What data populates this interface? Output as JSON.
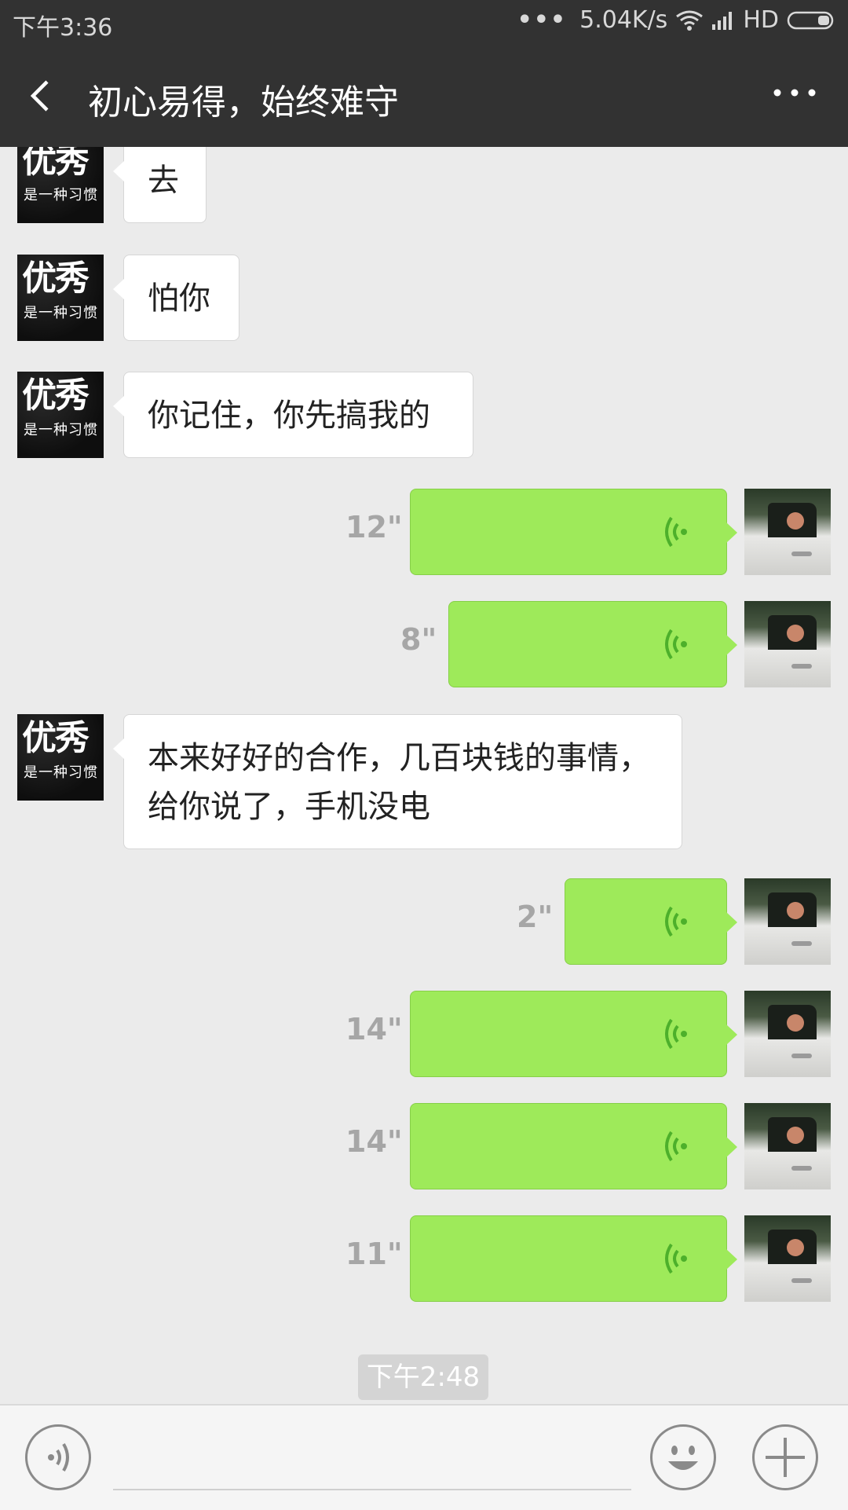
{
  "status_bar": {
    "time": "下午3:36",
    "signal_dots": "•••",
    "speed": "5.04K/s",
    "network_type": "HD"
  },
  "header": {
    "title": "初心易得，始终难守"
  },
  "contact_avatar": {
    "line1": "优秀",
    "line2": "是一种习惯"
  },
  "messages": [
    {
      "side": "left",
      "type": "text",
      "text": "去"
    },
    {
      "side": "left",
      "type": "text",
      "text": "怕你"
    },
    {
      "side": "left",
      "type": "text",
      "text": "你记住，你先搞我的"
    },
    {
      "side": "right",
      "type": "voice",
      "duration": "12\""
    },
    {
      "side": "right",
      "type": "voice",
      "duration": "8\""
    },
    {
      "side": "left",
      "type": "text",
      "text": "本来好好的合作，几百块钱的事情，给你说了，手机没电"
    },
    {
      "side": "right",
      "type": "voice",
      "duration": "2\""
    },
    {
      "side": "right",
      "type": "voice",
      "duration": "14\""
    },
    {
      "side": "right",
      "type": "voice",
      "duration": "14\""
    },
    {
      "side": "right",
      "type": "voice",
      "duration": "11\""
    }
  ],
  "timestamp": "下午2:48",
  "input": {
    "placeholder": "",
    "value": ""
  },
  "icons": {
    "back": "back-arrow-icon",
    "more": "more-dots-icon",
    "voice_input": "voice-input-icon",
    "emoji": "emoji-icon",
    "plus": "plus-icon",
    "voice_wave": "voice-wave-icon"
  },
  "colors": {
    "header_bg": "#323232",
    "chat_bg": "#ebebeb",
    "sent_bubble": "#9eea5a",
    "received_bubble": "#ffffff",
    "voice_icon": "#4db02b"
  }
}
